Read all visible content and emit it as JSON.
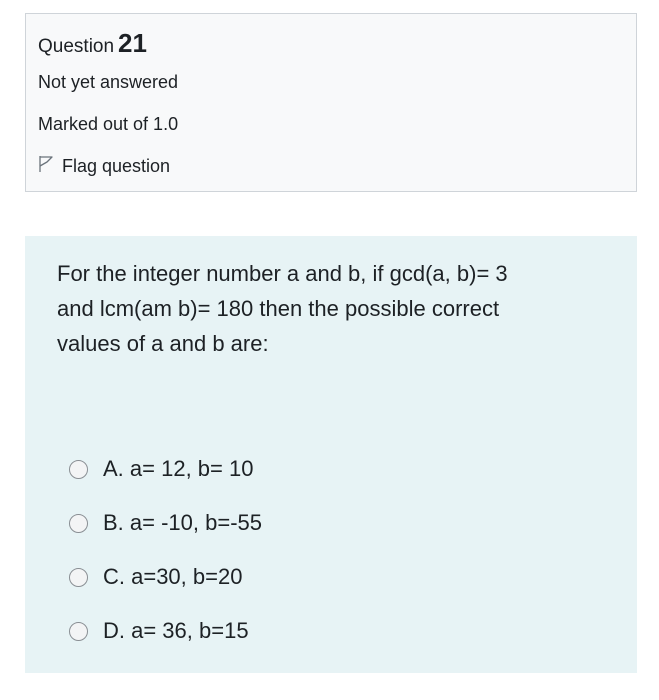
{
  "info": {
    "question_word": "Question",
    "question_number": "21",
    "state": "Not yet answered",
    "grade": "Marked out of 1.0",
    "flag_label": "Flag question"
  },
  "question": {
    "text": "For the integer number a and b, if gcd(a, b)= 3\n and  lcm(am b)= 180 then the possible correct\nvalues of a and b are:"
  },
  "answers": [
    {
      "label": "A. a= 12, b= 10"
    },
    {
      "label": "B. a= -10, b=-55"
    },
    {
      "label": "C. a=30, b=20"
    },
    {
      "label": "D. a= 36, b=15"
    }
  ],
  "colors": {
    "info_bg": "#f8f9fa",
    "content_bg": "#e7f3f5",
    "border": "#cfd4d9"
  }
}
